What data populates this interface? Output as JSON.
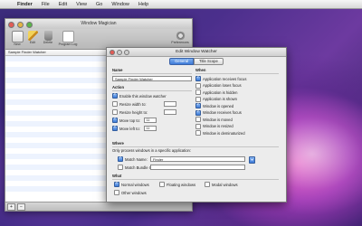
{
  "menubar": {
    "apple": "",
    "items": [
      "Finder",
      "File",
      "Edit",
      "View",
      "Go",
      "Window",
      "Help"
    ]
  },
  "main_window": {
    "title": "Window Magician",
    "toolbar": [
      "New",
      "Edit",
      "Delete",
      "Program Log",
      "Preferences"
    ],
    "list_item": "Sample Finder Watcher",
    "bottom_buttons": [
      "+",
      "−"
    ]
  },
  "dialog": {
    "title": "Edit Window Watcher",
    "tabs": [
      "General",
      "Title Scope"
    ],
    "name_section": "Name",
    "name_value": "Sample Finder Watcher",
    "action_section": "Action",
    "enable_label": "Enable this window watcher",
    "resize_width_label": "Resize width to:",
    "resize_height_label": "Resize height to:",
    "move_top_label": "Move top to:",
    "move_top_value": "11",
    "move_left_label": "Move left to:",
    "move_left_value": "11",
    "when_section": "When",
    "when_items": [
      {
        "label": "Application receives focus",
        "checked": true
      },
      {
        "label": "Application loses focus",
        "checked": false
      },
      {
        "label": "Application is hidden",
        "checked": false
      },
      {
        "label": "Application is shown",
        "checked": false
      },
      {
        "label": "Window is opened",
        "checked": true
      },
      {
        "label": "Window receives focus",
        "checked": true
      },
      {
        "label": "Window is moved",
        "checked": false
      },
      {
        "label": "Window is resized",
        "checked": false
      },
      {
        "label": "Window is deminaturized",
        "checked": false
      }
    ],
    "where_section": "Where",
    "where_desc": "Only process windows in a specific application:",
    "match_name_label": "Match Name:",
    "match_name_value": "Finder",
    "match_bundle_label": "Match Bundle ID:",
    "match_bundle_value": "",
    "what_section": "What",
    "what_items": [
      "Normal windows",
      "Floating windows",
      "Modal windows",
      "Other windows"
    ]
  },
  "colors": {
    "accent": "#3d7bd9",
    "row_alt": "#edf3fe"
  }
}
